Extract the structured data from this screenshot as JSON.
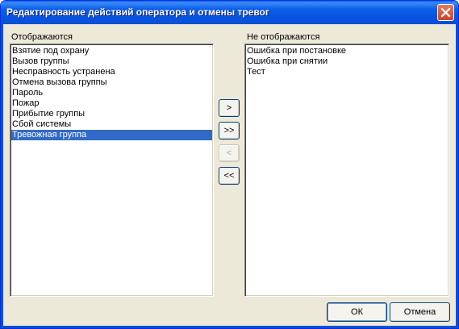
{
  "window": {
    "title": "Редактирование действий оператора и отмены тревог"
  },
  "shown": {
    "label": "Отображаются",
    "items": [
      "Взятие под охрану",
      "Вызов группы",
      "Несправность устранена",
      "Отмена вызова группы",
      "Пароль",
      "Пожар",
      "Прибытие группы",
      "Сбой системы",
      "Тревожная группа"
    ],
    "selected_index": 8
  },
  "hidden": {
    "label": "Не отображаются",
    "items": [
      "Ошибка при постановке",
      "Ошибка при снятии",
      "Тест"
    ]
  },
  "transfer": {
    "move_one_right": ">",
    "move_all_right": ">>",
    "move_one_left": "<",
    "move_all_left": "<<"
  },
  "footer": {
    "ok_label": "ОК",
    "cancel_label": "Отмена"
  }
}
